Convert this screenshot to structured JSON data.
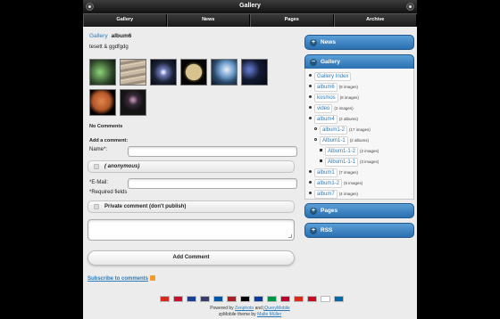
{
  "header": {
    "title": "Gallery",
    "home_icon": "home-icon",
    "search_icon": "search-icon"
  },
  "nav": [
    {
      "label": "Gallery"
    },
    {
      "label": "News"
    },
    {
      "label": "Pages"
    },
    {
      "label": "Archive"
    }
  ],
  "breadcrumb": {
    "parent": "Gallery",
    "current": "album6"
  },
  "album": {
    "description": "tesett & ggdfgdg",
    "thumbnails": [
      {
        "name": "nebula-green",
        "color": "#2f4a2a"
      },
      {
        "name": "jupiter",
        "color": "#9c8f7e"
      },
      {
        "name": "spiral-galaxy",
        "color": "#1d2438"
      },
      {
        "name": "moon",
        "color": "#8a7a55"
      },
      {
        "name": "earth",
        "color": "#2c4a6c"
      },
      {
        "name": "starfield",
        "color": "#121a33"
      },
      {
        "name": "mars",
        "color": "#b4572a"
      },
      {
        "name": "star-cluster",
        "color": "#141414"
      }
    ]
  },
  "comments": {
    "none_label": "No Comments",
    "add_heading": "Add a comment:",
    "name_label": "Name*:",
    "anonymous_label": "( anonymous)",
    "email_label": "*E-Mail:",
    "required_note": "*Required fields",
    "private_label": "Private comment (don't publish)",
    "submit_label": "Add Comment",
    "subscribe_label": "Subscribe to comments"
  },
  "sidebar": {
    "news": "News",
    "gallery": "Gallery",
    "pages": "Pages",
    "rss": "RSS",
    "tree": [
      {
        "label": "Gallery Index",
        "count": "",
        "level": 0
      },
      {
        "label": "album6",
        "count": "(8 images)",
        "level": 0
      },
      {
        "label": "kosmos",
        "count": "(8 images)",
        "level": 0
      },
      {
        "label": "video",
        "count": "(2 images)",
        "level": 0
      },
      {
        "label": "album4",
        "count": "(2 albums)",
        "level": 0
      },
      {
        "label": "album1-2",
        "count": "(17 images)",
        "level": 1
      },
      {
        "label": "Album1-1",
        "count": "(2 albums)",
        "level": 1
      },
      {
        "label": "Album1-1-2",
        "count": "(2 images)",
        "level": 2
      },
      {
        "label": "Album1-1-1",
        "count": "(3 images)",
        "level": 2
      },
      {
        "label": "album1",
        "count": "(7 images)",
        "level": 0
      },
      {
        "label": "album1-2",
        "count": "(5 images)",
        "level": 0
      },
      {
        "label": "album7",
        "count": "(4 images)",
        "level": 0
      }
    ]
  },
  "footer": {
    "powered_prefix": "Powered by",
    "zenphoto": "Zenphoto",
    "and": "and",
    "jquerymobile": "jQueryMobile",
    "theme_prefix": "zpMobile theme by",
    "author": "Malte Müller",
    "flags": [
      "#d52b1e",
      "#c8102e",
      "#1c3f94",
      "#3c3b6e",
      "#0055a4",
      "#ae1c28",
      "#000000",
      "#0a3a9e",
      "#009246",
      "#bc002d",
      "#d52b1e",
      "#c60b1e",
      "#ffffff",
      "#006aa7"
    ]
  }
}
